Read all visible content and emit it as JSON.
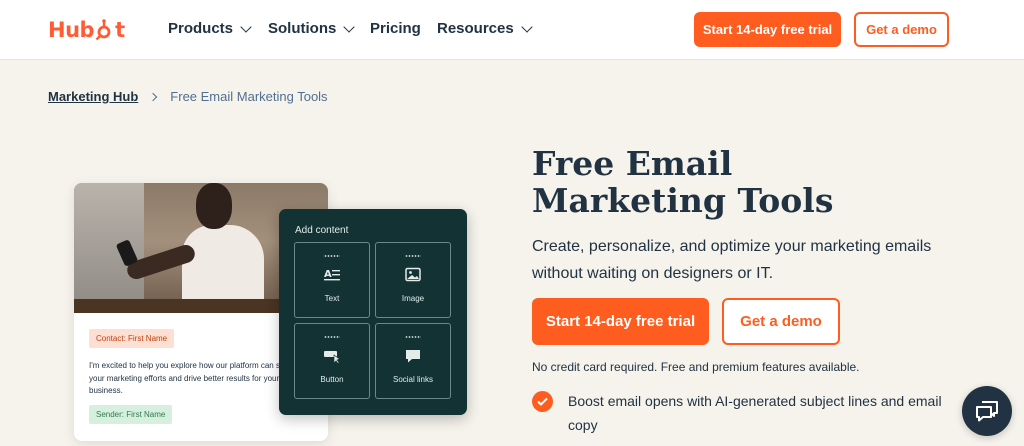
{
  "nav": {
    "logo": {
      "pre": "Hub",
      "post": "t"
    },
    "items": [
      {
        "label": "Products",
        "has_dropdown": true
      },
      {
        "label": "Solutions",
        "has_dropdown": true
      },
      {
        "label": "Pricing",
        "has_dropdown": false
      },
      {
        "label": "Resources",
        "has_dropdown": true
      }
    ],
    "trial_button": "Start 14-day free trial",
    "demo_button": "Get a demo"
  },
  "breadcrumb": {
    "parent": "Marketing Hub",
    "current": "Free Email Marketing Tools"
  },
  "hero": {
    "title": "Free Email Marketing Tools",
    "description": "Create, personalize, and optimize your marketing emails without waiting on designers or IT.",
    "trial_button": "Start 14-day free trial",
    "demo_button": "Get a demo",
    "note": "No credit card required. Free and premium features available.",
    "feature": "Boost email opens with AI-generated subject lines and email copy"
  },
  "illustration": {
    "contact_tag": "Contact: First Name",
    "email_body": "I'm excited to help you explore how our platform can streamline your marketing efforts and drive better results for your business.",
    "sender_tag": "Sender: First Name",
    "panel_title": "Add content",
    "tiles": [
      {
        "label": "Text",
        "icon": "text-icon"
      },
      {
        "label": "Image",
        "icon": "image-icon"
      },
      {
        "label": "Button",
        "icon": "button-icon"
      },
      {
        "label": "Social links",
        "icon": "chat-bubble-icon"
      }
    ]
  },
  "colors": {
    "brand_orange": "#ff5c1f",
    "navy": "#213343",
    "panel_teal": "#123234",
    "page_bg": "#f6f3ec"
  },
  "chat_widget": {
    "icon": "chat-icon"
  }
}
